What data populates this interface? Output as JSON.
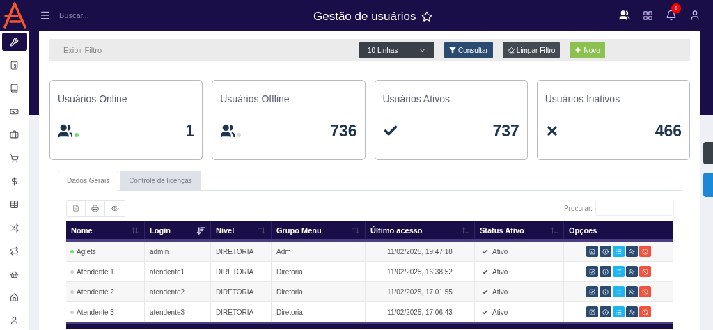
{
  "topbar": {
    "search_placeholder": "Buscar...",
    "title": "Gestão de usuários",
    "notifications": "6"
  },
  "sidebar": {
    "items": [
      {
        "selected": true
      },
      {
        "selected": false
      },
      {
        "selected": false
      },
      {
        "selected": false
      },
      {
        "selected": false
      },
      {
        "selected": false
      },
      {
        "selected": false
      },
      {
        "selected": false
      },
      {
        "selected": false
      },
      {
        "selected": false
      },
      {
        "selected": false
      },
      {
        "selected": false
      },
      {
        "selected": false
      }
    ]
  },
  "filter_bar": {
    "label": "Exibir Filtro",
    "rows_select": "10 Linhas",
    "buttons": [
      {
        "kind": "query",
        "label": "Consultar"
      },
      {
        "kind": "clear",
        "label": "Limpar Filtro"
      },
      {
        "kind": "new",
        "label": "Novo"
      }
    ]
  },
  "cards": [
    {
      "title": "Usuários Online",
      "kind": "online",
      "value": "1"
    },
    {
      "title": "Usuários Offline",
      "kind": "offline",
      "value": "736"
    },
    {
      "title": "Usuários Ativos",
      "kind": "active",
      "value": "737"
    },
    {
      "title": "Usuários Inativos",
      "kind": "inactive",
      "value": "466"
    }
  ],
  "tabs": [
    {
      "label": "Dados Gerais",
      "selected": true
    },
    {
      "label": "Controle de licenças",
      "selected": false
    }
  ],
  "table": {
    "search_label": "Procurar:",
    "columns": [
      {
        "label": "Nome",
        "sortable": true,
        "sorted": false
      },
      {
        "label": "Login",
        "sortable": true,
        "sorted": true
      },
      {
        "label": "Nível",
        "sortable": true,
        "sorted": false
      },
      {
        "label": "Grupo Menu",
        "sortable": true,
        "sorted": false
      },
      {
        "label": "Último acesso",
        "sortable": true,
        "sorted": false
      },
      {
        "label": "Status Ativo",
        "sortable": true,
        "sorted": false
      },
      {
        "label": "Opções",
        "sortable": false,
        "sorted": false
      }
    ],
    "rows": [
      {
        "online": true,
        "name": "Aglets",
        "login": "admin",
        "level": "DIRETORIA",
        "group": "Adm",
        "last_access": "11/02/2025, 19:47:18",
        "status": "Ativo"
      },
      {
        "online": false,
        "name": "Atendente 1",
        "login": "atendente1",
        "level": "DIRETORIA",
        "group": "Diretoria",
        "last_access": "11/02/2025, 16:38:52",
        "status": "Ativo"
      },
      {
        "online": false,
        "name": "Atendente 2",
        "login": "atendente2",
        "level": "DIRETORIA",
        "group": "Diretoria",
        "last_access": "11/02/2025, 17:01:55",
        "status": "Ativo"
      },
      {
        "online": false,
        "name": "Atendente 3",
        "login": "atendente3",
        "level": "DIRETORIA",
        "group": "Diretoria",
        "last_access": "11/02/2025, 17:06:43",
        "status": "Ativo"
      }
    ]
  }
}
